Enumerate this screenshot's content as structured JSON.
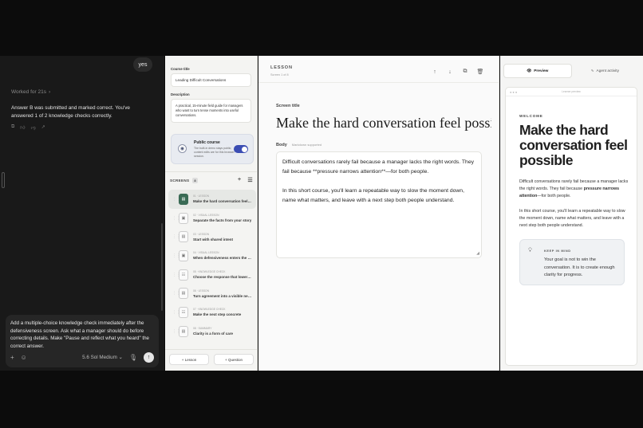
{
  "chat": {
    "user_reply": "yes",
    "worked_for": "Worked for 21s",
    "answer": "Answer B was submitted and marked correct. You've answered 1 of 2 knowledge checks correctly.",
    "composer_text": "Add a multiple-choice knowledge check immediately after the defensiveness screen. Ask what a manager should do before correcting details. Make \"Pause and reflect what you heard\" the correct answer.",
    "model": "5.6 Sol Medium"
  },
  "sidebar": {
    "course_title_label": "Course title",
    "course_title": "Leading Difficult Conversations",
    "description_label": "Description",
    "description": "A practical, 15-minute field guide for managers who want to turn tense moments into useful conversations.",
    "public_title": "Public course",
    "public_desc": "The built-in demo stays public; content edits are for this browser session.",
    "public_enabled": true,
    "screens_label": "SCREENS",
    "screens_count": "8",
    "screens": [
      {
        "type": "01 · LESSON",
        "title": "Make the hard conversation feel possible",
        "icon": "doc-icon"
      },
      {
        "type": "02 · VISUAL LESSON",
        "title": "Separate the facts from your story",
        "icon": "image-icon"
      },
      {
        "type": "03 · LESSON",
        "title": "Start with shared intent",
        "icon": "doc-icon"
      },
      {
        "type": "04 · VISUAL LESSON",
        "title": "When defensiveness enters the room",
        "icon": "image-icon"
      },
      {
        "type": "05 · KNOWLEDGE CHECK",
        "title": "Choose the response that lowers tension",
        "icon": "checklist-icon"
      },
      {
        "type": "06 · LESSON",
        "title": "Turn agreement into a visible next step",
        "icon": "doc-icon"
      },
      {
        "type": "07 · KNOWLEDGE CHECK",
        "title": "Make the next step concrete",
        "icon": "checklist-icon"
      },
      {
        "type": "08 · SUMMARY",
        "title": "Clarity is a form of care",
        "icon": "doc-icon"
      }
    ],
    "add_lesson": "Lesson",
    "add_question": "Question"
  },
  "editor": {
    "section_label": "LESSON",
    "section_sub": "Screen 1 of 8",
    "screen_title_label": "Screen title",
    "screen_title": "Make the hard conversation feel possible",
    "body_label": "Body",
    "body_hint": "Markdown supported",
    "body_p1": "Difficult conversations rarely fail because a manager lacks the right words. They fail because **pressure narrows attention**—for both people.",
    "body_p2": "In this short course, you'll learn a repeatable way to slow the moment down, name what matters, and leave with a next step both people understand."
  },
  "preview": {
    "tab_preview": "Preview",
    "tab_activity": "Agent activity",
    "url": "Learner preview",
    "kicker": "WELCOME",
    "title": "Make the hard conversation feel possible",
    "p1_start": "Difficult conversations rarely fail because a manager lacks the right words. They fail because ",
    "p1_bold": "pressure narrows attention",
    "p1_end": "—for both people.",
    "p2": "In this short course, you'll learn a repeatable way to slow the moment down, name what matters, and leave with a next step both people understand.",
    "keep_title": "KEEP IN MIND",
    "keep_body": "Your goal is not to win the conversation. It is to create enough clarity for progress."
  }
}
